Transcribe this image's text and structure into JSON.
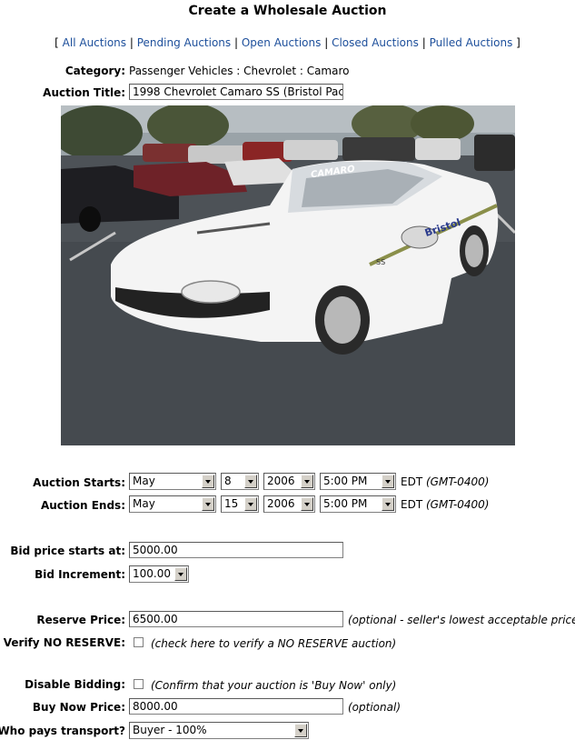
{
  "page": {
    "title": "Create a Wholesale Auction"
  },
  "nav": {
    "open_bracket": "[",
    "close_bracket": "]",
    "separator": "|",
    "links": [
      "All Auctions",
      "Pending Auctions",
      "Open Auctions",
      "Closed Auctions",
      "Pulled Auctions"
    ]
  },
  "category": {
    "label": "Category:",
    "value": "Passenger Vehicles : Chevrolet : Camaro"
  },
  "auction_title": {
    "label": "Auction Title:",
    "value": "1998 Chevrolet Camaro SS (Bristol Pac"
  },
  "photo": {
    "decal_text": "CAMARO",
    "sponsor_text": "Bristol",
    "badge_text": "SS"
  },
  "auction_starts": {
    "label": "Auction Starts:",
    "month": "May",
    "day": "8",
    "year": "2006",
    "time": "5:00 PM",
    "tz": "EDT",
    "tz_offset": "(GMT-0400)"
  },
  "auction_ends": {
    "label": "Auction Ends:",
    "month": "May",
    "day": "15",
    "year": "2006",
    "time": "5:00 PM",
    "tz": "EDT",
    "tz_offset": "(GMT-0400)"
  },
  "bid_start": {
    "label": "Bid price starts at:",
    "value": "5000.00"
  },
  "bid_increment": {
    "label": "Bid Increment:",
    "value": "100.00"
  },
  "reserve": {
    "label": "Reserve Price:",
    "value": "6500.00",
    "note": "(optional - seller's lowest acceptable price)"
  },
  "verify_no_reserve": {
    "label": "Verify NO RESERVE:",
    "note": "(check here to verify a NO RESERVE auction)",
    "checked": false
  },
  "disable_bidding": {
    "label": "Disable Bidding:",
    "note": "(Confirm that your auction is 'Buy Now' only)",
    "checked": false
  },
  "buy_now": {
    "label": "Buy Now Price:",
    "value": "8000.00",
    "note": "(optional)"
  },
  "transport": {
    "label": "Who pays transport?",
    "value": "Buyer - 100%"
  }
}
